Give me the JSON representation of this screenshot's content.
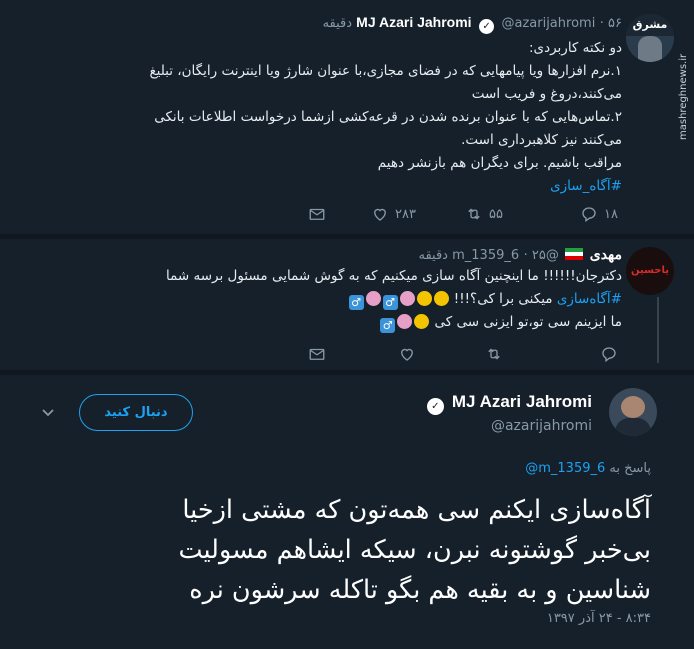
{
  "tweet1": {
    "name": "MJ Azari Jahromi",
    "handle": "@azarijahromi",
    "time": "۵۶ دقیقه",
    "lines": [
      "دو نکته کاربردی:",
      "۱.نرم افزارها ویا پیامهایی که در فضای مجازی،با عنوان شارژ ویا اینترنت رایگان، تبلیغ",
      "می‌کنند،دروغ و فریب است",
      "۲.تماس‌هایی که با عنوان برنده شدن در قرعه‌کشی ازشما درخواست اطلاعات بانکی",
      "می‌کنند نیز کلاهبرداری است.",
      "مراقب باشیم. برای دیگران هم بازنشر دهیم"
    ],
    "hashtag": "#آگاه_سازی",
    "avatar_text": "مشرق",
    "avatar_side_text": "mashreghnews.ir",
    "replies": "۱۸",
    "retweets": "۵۵",
    "likes": "۲۸۳"
  },
  "tweet2": {
    "name": "مهدی",
    "handle": "@m_1359_6",
    "time": "۲۵ دقیقه",
    "line1": "دکترجان!!!!!! ما اینچنین آگاه سازی میکنیم که به گوش شمایی مسئول برسه شما",
    "line2_hashtag": "#آگاه‌سازی",
    "line2_text": "میکنی برا کی؟!!!",
    "line3": "ما ایزینم سی تو،تو ایزنی سی کی",
    "avatar_text": "یاحسین",
    "male_sign": "♂"
  },
  "tweet3": {
    "name": "MJ Azari Jahromi",
    "handle": "@azarijahromi",
    "follow_label": "دنبال کنید",
    "reply_prefix": "پاسخ به",
    "reply_handle": "@m_1359_6",
    "lines": [
      "آگاه‌سازی ایکنم سی همه‌تون که مشتی ازخیا",
      "بی‌خبر گوشتونه نبرن، سیکه ایشاهم مسولیت",
      "شناسین و به بقیه هم بگو تاکله سرشون نره"
    ],
    "timestamp": "۸:۳۴ - ۲۴ آذر ۱۳۹۷"
  },
  "icons": {
    "verified": "verified-badge-icon",
    "reply": "reply-icon",
    "retweet": "retweet-icon",
    "like": "heart-icon",
    "dm": "envelope-icon",
    "more": "chevron-down-icon"
  },
  "colors": {
    "background": "#15202b",
    "separator": "#10171e",
    "accent": "#1da1f2",
    "muted": "#8899a6",
    "text": "#e6ecf0"
  }
}
